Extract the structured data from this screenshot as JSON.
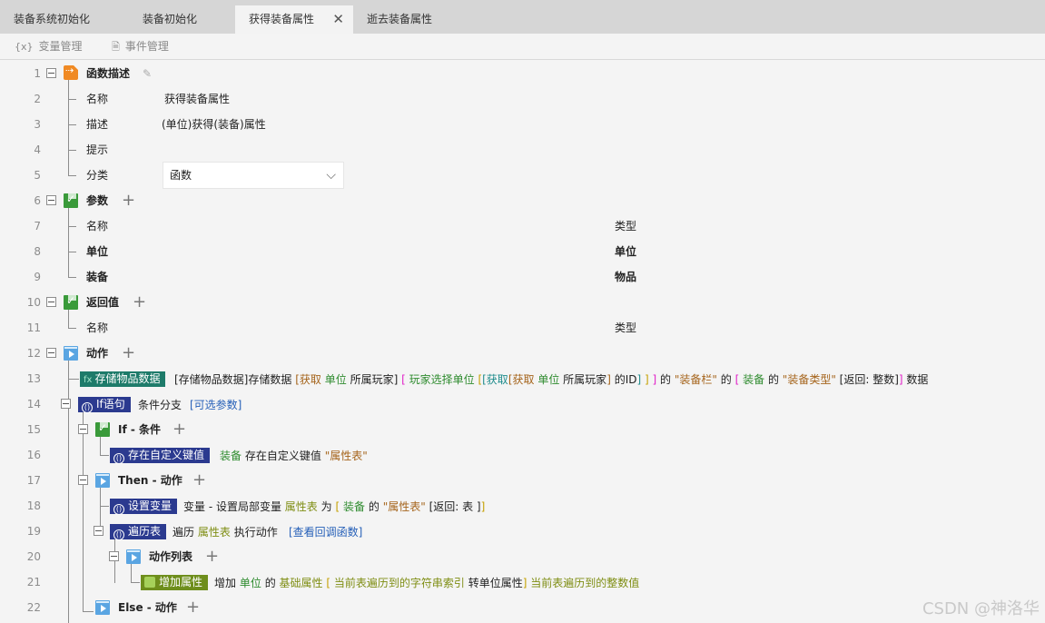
{
  "tabs": [
    {
      "label": "装备系统初始化"
    },
    {
      "label": "装备初始化"
    },
    {
      "label": "获得装备属性",
      "close": "✕"
    },
    {
      "label": "逝去装备属性"
    }
  ],
  "toolbar": {
    "var_icon": "{x}",
    "var_label": "变量管理",
    "event_label": "事件管理"
  },
  "lines": [
    "1",
    "2",
    "3",
    "4",
    "5",
    "6",
    "7",
    "8",
    "9",
    "10",
    "11",
    "12",
    "13",
    "14",
    "15",
    "16",
    "17",
    "18",
    "19",
    "20",
    "21",
    "22"
  ],
  "func_desc": {
    "title": "函数描述",
    "name_label": "名称",
    "name_value": "获得装备属性",
    "desc_label": "描述",
    "desc_value": "(单位)获得(装备)属性",
    "hint_label": "提示",
    "category_label": "分类",
    "category_value": "函数"
  },
  "params": {
    "title": "参数",
    "col_name": "名称",
    "col_type": "类型",
    "rows": [
      {
        "name": "单位",
        "type": "单位"
      },
      {
        "name": "装备",
        "type": "物品"
      }
    ]
  },
  "returns": {
    "title": "返回值",
    "col_name": "名称",
    "col_type": "类型"
  },
  "actions": {
    "title": "动作",
    "store": {
      "badge": "存储物品数据",
      "p1": "[存储物品数据]存储数据",
      "p2": "[获取",
      "p3": "单位",
      "p4": "所属玩家]",
      "p5": "[",
      "p6": "玩家选择单位",
      "p7": "[",
      "p8": "[获取",
      "p9": "[获取",
      "p10": "单位",
      "p11": "所属玩家",
      "p12": "]",
      "p13": "的ID",
      "p14": "]",
      "p15": "]",
      "p16": "]",
      "p17": "的",
      "p18": "\"装备栏\"",
      "p19": "的",
      "p20": "[",
      "p21": "装备",
      "p22": "的",
      "p23": "\"装备类型\"",
      "p24": "[返回: 整数]",
      "p25": "]",
      "p26": "数据"
    },
    "if": {
      "badge": "If语句",
      "label": "条件分支",
      "optional": "[可选参数]",
      "cond_title": "If - 条件",
      "cond_badge": "存在自定义键值",
      "cond_p1": "装备",
      "cond_p2": "存在自定义键值",
      "cond_p3": "\"属性表\"",
      "then_title": "Then - 动作",
      "set_badge": "设置变量",
      "set_p1": "变量 - 设置局部变量",
      "set_p2": "属性表",
      "set_p3": "为",
      "set_p4": "[",
      "set_p5": "装备",
      "set_p6": "的",
      "set_p7": "\"属性表\"",
      "set_p8": "[返回: 表 ]",
      "set_p9": "]",
      "iter_badge": "遍历表",
      "iter_p1": "遍历",
      "iter_p2": "属性表",
      "iter_p3": "执行动作",
      "iter_p4": "[查看回调函数]",
      "list_title": "动作列表",
      "add_badge": "增加属性",
      "add_p1": "增加",
      "add_p2": "单位",
      "add_p3": "的",
      "add_p4": "基础属性",
      "add_p5": "[",
      "add_p6": "当前表遍历到的字符串索引",
      "add_p7": "转单位属性",
      "add_p8": "]",
      "add_p9": "当前表遍历到的整数值",
      "else_title": "Else - 动作"
    }
  },
  "watermark": "CSDN @神洛华"
}
